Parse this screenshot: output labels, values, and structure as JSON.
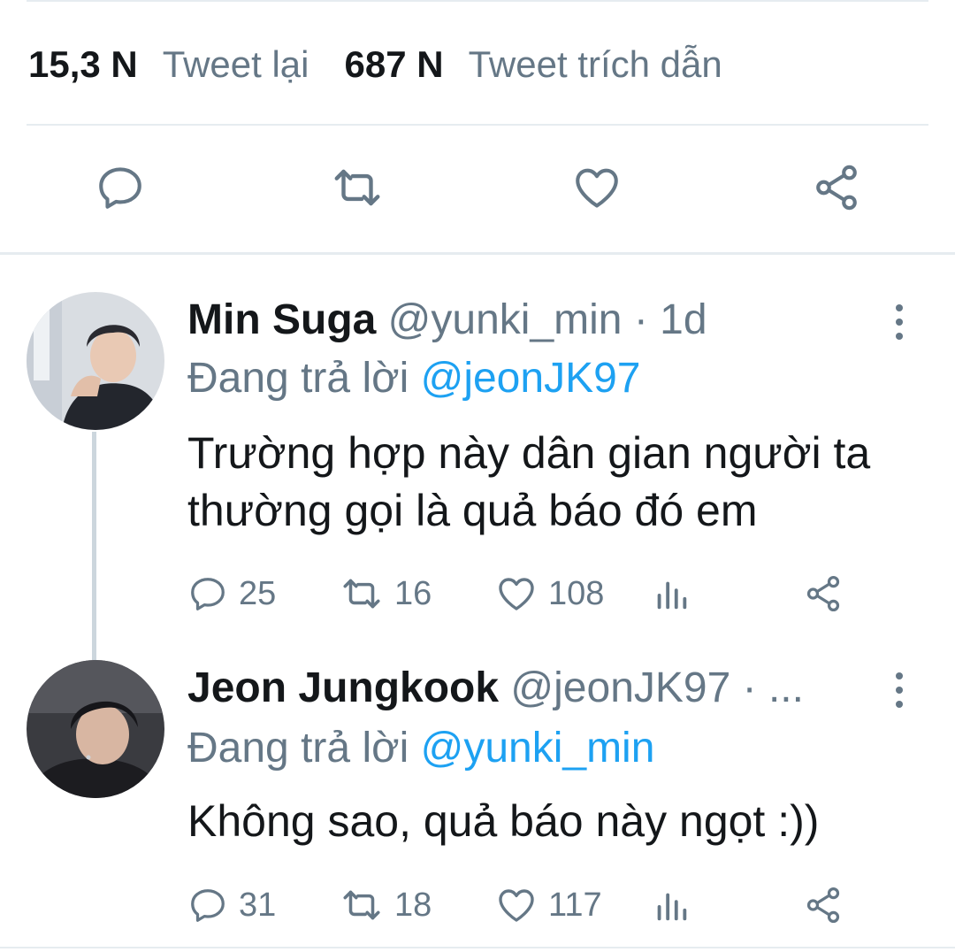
{
  "stats": {
    "retweets_count": "15,3 N",
    "retweets_label": "Tweet lại",
    "quotes_count": "687 N",
    "quotes_label": "Tweet trích dẫn"
  },
  "actions": {
    "icons": [
      "reply-icon",
      "retweet-icon",
      "like-icon",
      "share-icon"
    ]
  },
  "tweets": [
    {
      "name": "Min Suga",
      "handle": "@yunki_min · 1d",
      "reply_prefix": "Đang trả lời",
      "reply_to": "@jeonJK97",
      "text": "Trường hợp này dân gian người ta thường gọi là quả báo đó em",
      "replies": "25",
      "retweets": "16",
      "likes": "108"
    },
    {
      "name": "Jeon Jungkook",
      "handle": "@jeonJK97 · ...",
      "reply_prefix": "Đang trả lời",
      "reply_to": "@yunki_min",
      "text": "Không sao, quả báo này ngọt :))",
      "replies": "31",
      "retweets": "18",
      "likes": "117"
    }
  ],
  "colors": {
    "text_primary": "#14171a",
    "text_secondary": "#657786",
    "link": "#1da1f2",
    "divider": "#e6ecf0",
    "thread_line": "#ccd6dd"
  }
}
